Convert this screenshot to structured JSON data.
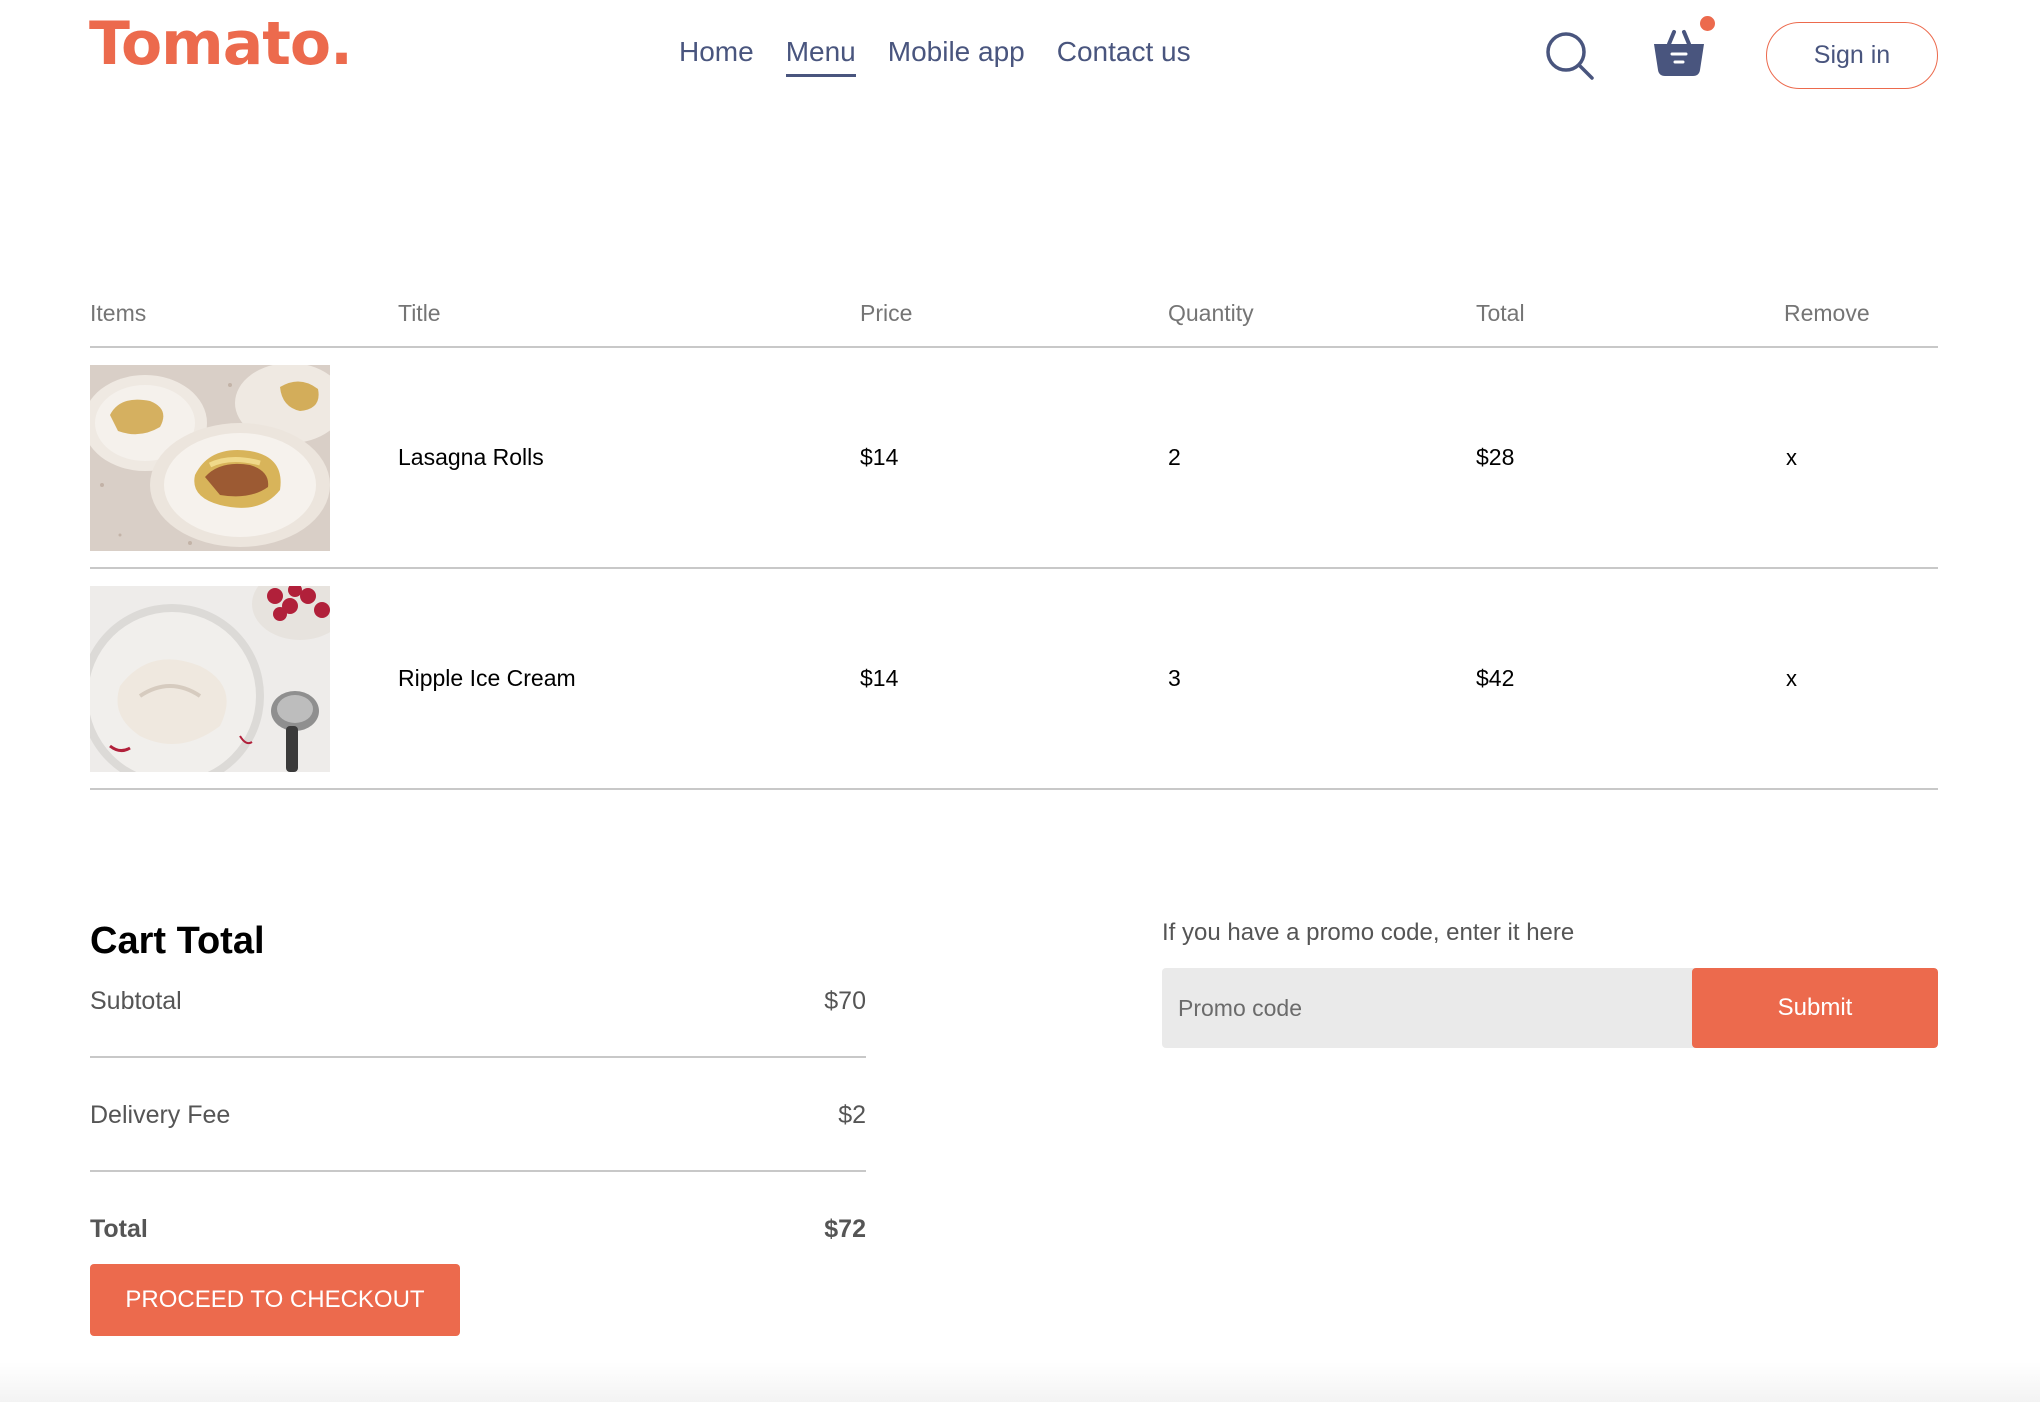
{
  "brand": {
    "logo_text": "Tomato.",
    "accent_color": "#ec6a4d",
    "nav_color": "#49557e"
  },
  "navbar": {
    "links": [
      {
        "label": "Home",
        "active": false
      },
      {
        "label": "Menu",
        "active": true
      },
      {
        "label": "Mobile app",
        "active": false
      },
      {
        "label": "Contact us",
        "active": false
      }
    ],
    "icons": [
      "search-icon",
      "basket-icon"
    ],
    "cart_has_items": true,
    "signin_label": "Sign in"
  },
  "cart": {
    "headers": [
      "Items",
      "Title",
      "Price",
      "Quantity",
      "Total",
      "Remove"
    ],
    "items": [
      {
        "image": "lasagna-rolls-photo",
        "title": "Lasagna Rolls",
        "price": "$14",
        "quantity": "2",
        "total": "$28",
        "remove": "x"
      },
      {
        "image": "ripple-ice-cream-photo",
        "title": "Ripple Ice Cream",
        "price": "$14",
        "quantity": "3",
        "total": "$42",
        "remove": "x"
      }
    ]
  },
  "totals": {
    "heading": "Cart Total",
    "subtotal_label": "Subtotal",
    "subtotal_value": "$70",
    "delivery_label": "Delivery Fee",
    "delivery_value": "$2",
    "total_label": "Total",
    "total_value": "$72",
    "checkout_label": "PROCEED TO CHECKOUT"
  },
  "promo": {
    "prompt": "If you have a promo code, enter it here",
    "placeholder": "Promo code",
    "submit_label": "Submit"
  }
}
